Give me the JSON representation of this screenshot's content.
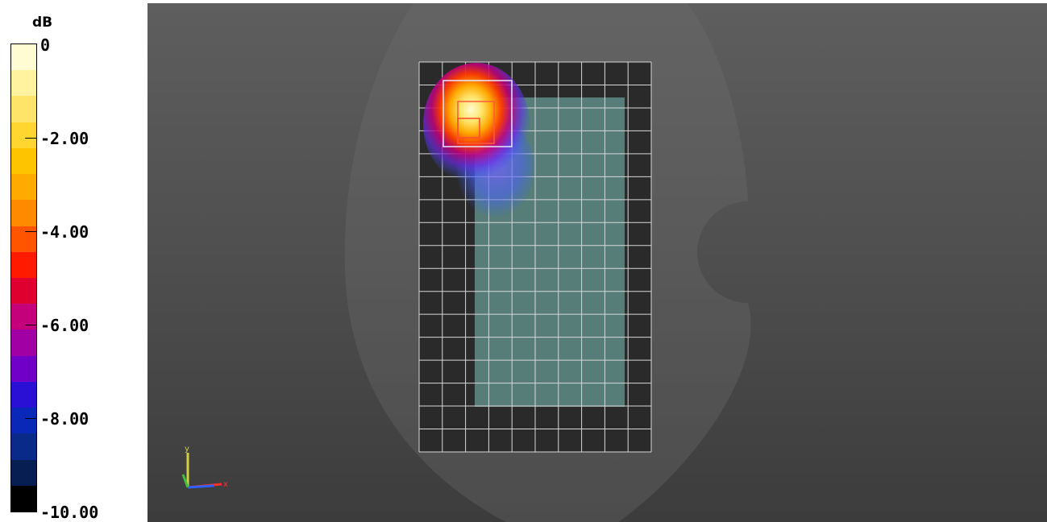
{
  "legend": {
    "unit": "dB",
    "labels": [
      "0",
      "-2.00",
      "-4.00",
      "-6.00",
      "-8.00",
      "-10.00"
    ],
    "colors": [
      "#fffbd2",
      "#fff3a0",
      "#ffe46a",
      "#ffd530",
      "#ffc400",
      "#ffaa00",
      "#ff8a00",
      "#ff5500",
      "#ff1a00",
      "#e00030",
      "#c4007a",
      "#a000a4",
      "#7000c8",
      "#2a10d4",
      "#0a28b8",
      "#0a2a8a",
      "#061e52",
      "#000000"
    ]
  },
  "viewport": {
    "icons": [
      "axis-triad-icon"
    ],
    "axis_labels": {
      "y": "y",
      "x": "x"
    }
  }
}
